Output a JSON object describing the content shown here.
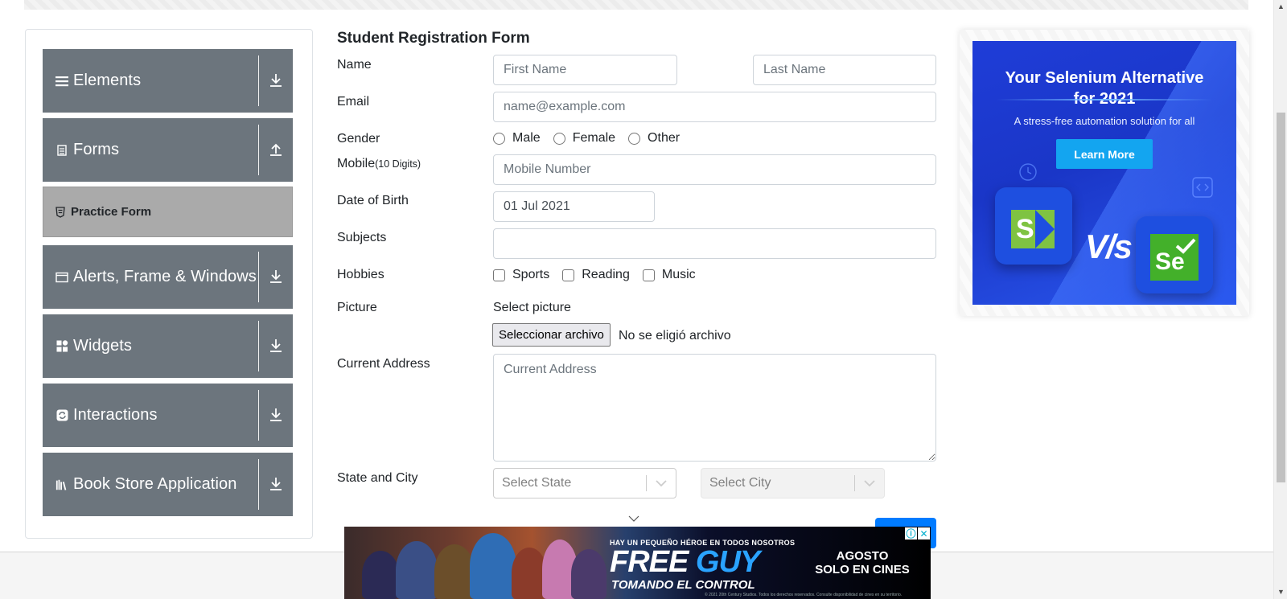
{
  "sidebar": {
    "groups": [
      {
        "label": "Elements",
        "icon": "hamburger-icon",
        "toggle": "expand-arrow-icon"
      },
      {
        "label": "Forms",
        "icon": "document-icon",
        "toggle": "collapse-arrow-icon"
      },
      {
        "label": "Alerts, Frame & Windows",
        "icon": "window-icon",
        "toggle": "expand-arrow-icon"
      },
      {
        "label": "Widgets",
        "icon": "widgets-grid-icon",
        "toggle": "expand-arrow-icon"
      },
      {
        "label": "Interactions",
        "icon": "refresh-icon",
        "toggle": "expand-arrow-icon"
      },
      {
        "label": "Book Store Application",
        "icon": "books-icon",
        "toggle": "expand-arrow-icon"
      }
    ],
    "active_item": {
      "label": "Practice Form",
      "icon": "html5-icon"
    }
  },
  "form": {
    "title": "Student Registration Form",
    "name_label": "Name",
    "first_name_placeholder": "First Name",
    "last_name_placeholder": "Last Name",
    "email_label": "Email",
    "email_placeholder": "name@example.com",
    "gender_label": "Gender",
    "gender_options": [
      "Male",
      "Female",
      "Other"
    ],
    "mobile_label": "Mobile",
    "mobile_hint": "(10 Digits)",
    "mobile_placeholder": "Mobile Number",
    "dob_label": "Date of Birth",
    "dob_value": "01 Jul 2021",
    "subjects_label": "Subjects",
    "subjects_value": "",
    "hobbies_label": "Hobbies",
    "hobby_options": [
      "Sports",
      "Reading",
      "Music"
    ],
    "picture_label": "Picture",
    "picture_prompt": "Select picture",
    "file_button": "Seleccionar archivo",
    "file_status": "No se eligió archivo",
    "address_label": "Current Address",
    "address_placeholder": "Current Address",
    "state_city_label": "State and City",
    "state_placeholder": "Select State",
    "city_placeholder": "Select City"
  },
  "ad_right": {
    "headline_line1": "Your Selenium Alternative",
    "headline_line2": "for 2021",
    "subtitle": "A stress-free automation solution for all",
    "cta": "Learn More",
    "vs": "V/s",
    "left_logo": "S",
    "right_logo": "Se"
  },
  "ad_bottom": {
    "tagline": "HAY UN PEQUEÑO HÉROE EN TODOS NOSOTROS",
    "title_part1": "FREE",
    "title_part2": "GUY",
    "subtitle": "TOMANDO EL CONTROL",
    "right_line1": "AGOSTO",
    "right_line2": "SOLO EN CINES",
    "legal": "© 2021 20th Century Studios. Todos los derechos reservados. Consulte disponibilidad de cines en su territorio.",
    "info_icon": "ⓘ",
    "close_icon": "✕"
  },
  "colors": {
    "sidebar_group_bg": "#6c757d",
    "sidebar_active_bg": "#aaaaaa",
    "primary": "#007bff",
    "ad_blue": "#1f3dd8"
  }
}
